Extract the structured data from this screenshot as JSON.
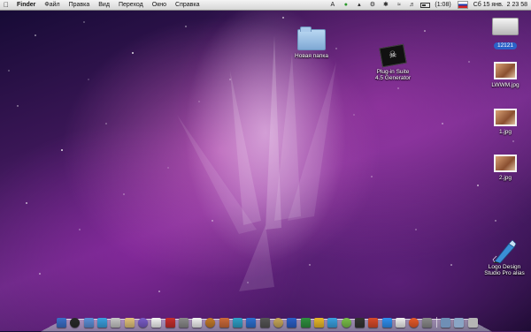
{
  "menubar": {
    "apple_icon": "apple-icon",
    "items": [
      "Finder",
      "Файл",
      "Правка",
      "Вид",
      "Переход",
      "Окно",
      "Справка"
    ],
    "status": {
      "icons": [
        "adobe-icon",
        "green-circle-icon",
        "cat-icon",
        "cog-icon",
        "bluetooth-icon",
        "wifi-icon",
        "volume-icon",
        "battery-icon"
      ],
      "battery_text": "(1:08)",
      "clock": "Сб 15 янв.  2 23 58"
    }
  },
  "desktop": {
    "icons": [
      {
        "label": "Новая папка",
        "type": "folder"
      },
      {
        "label_line1": "Plug-in Suite",
        "label_line2": "4.5 Generator",
        "type": "pirate"
      },
      {
        "label": "12121",
        "type": "drive"
      },
      {
        "label": "LWWM.jpg",
        "type": "image"
      },
      {
        "label": "1.jpg",
        "type": "image"
      },
      {
        "label": "2.jpg",
        "type": "image"
      },
      {
        "label_line1": "Logo Design",
        "label_line2": "Studio Pro alias",
        "type": "alias"
      }
    ]
  },
  "dock": {
    "apps": [
      "#3b6fc9",
      "#2a2a2a",
      "#5b8fd8",
      "#3aa0e0",
      "#c7c7c7",
      "#e2c27a",
      "#7a5cc9",
      "#f4f4f4",
      "#c62e2e",
      "#8a8a8a",
      "#f2f2f2",
      "#c47a2a",
      "#cc6a3a",
      "#2fa0c8",
      "#2d6fd0",
      "#555555",
      "#c8a85a",
      "#2b5fc8",
      "#2f8f3f",
      "#e8b82a",
      "#3aa0e0",
      "#7ac04a",
      "#333333",
      "#d84a2a",
      "#2f8ff0",
      "#f0f0f0",
      "#e85a2a",
      "#8a8a8a"
    ],
    "trailing": [
      "#6f8fb5",
      "#8aa5c5",
      "#b5b5b5"
    ]
  }
}
